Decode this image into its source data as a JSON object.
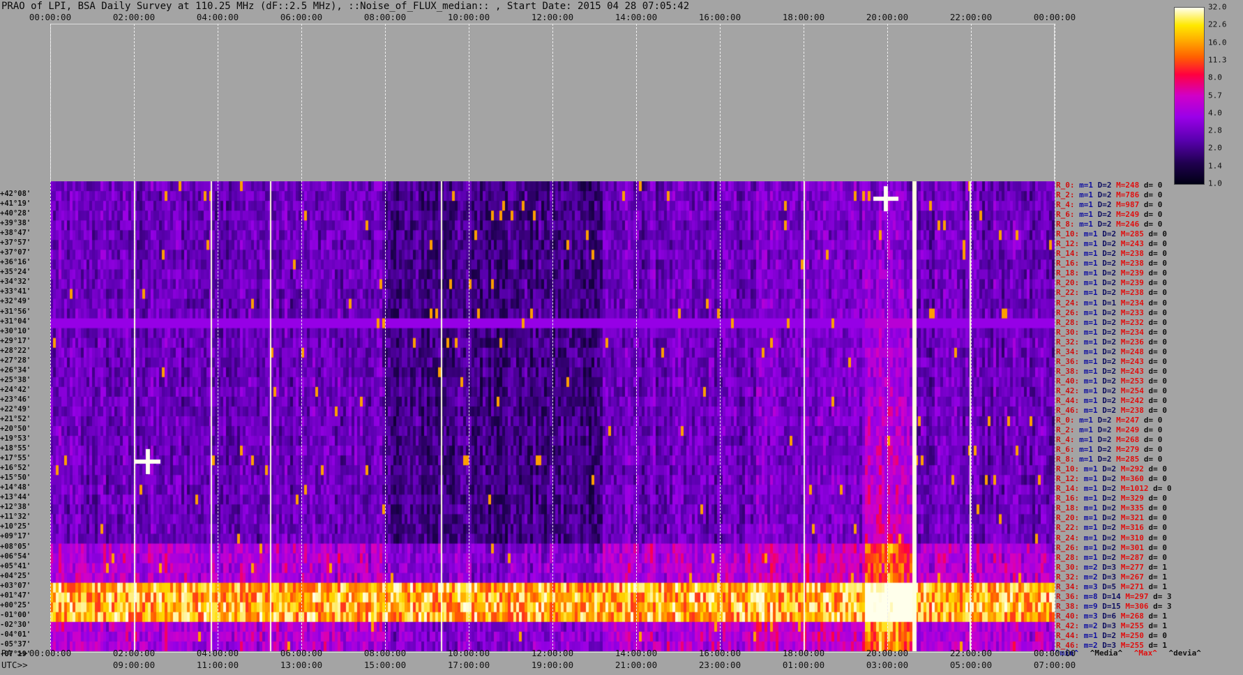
{
  "title": "PRAO of LPI, BSA Daily Survey at 110.25 MHz (dF::2.5 MHz), ::Noise_of_FLUX_median:: , Start Date: 2015 04 28 07:05:42",
  "top_axis": [
    "00:00:00",
    "02:00:00",
    "04:00:00",
    "06:00:00",
    "08:00:00",
    "10:00:00",
    "12:00:00",
    "14:00:00",
    "16:00:00",
    "18:00:00",
    "20:00:00",
    "22:00:00",
    "00:00:00"
  ],
  "ra_label": "RA >>",
  "ra_axis": [
    "00:00:00",
    "02:00:00",
    "04:00:00",
    "06:00:00",
    "08:00:00",
    "10:00:00",
    "12:00:00",
    "14:00:00",
    "16:00:00",
    "18:00:00",
    "20:00:00",
    "22:00:00",
    "00:00:00"
  ],
  "utc_label": "UTC>>",
  "utc_axis": [
    "09:00:00",
    "11:00:00",
    "13:00:00",
    "15:00:00",
    "17:00:00",
    "19:00:00",
    "21:00:00",
    "23:00:00",
    "01:00:00",
    "03:00:00",
    "05:00:00",
    "07:00:00"
  ],
  "declinations": [
    "+42°08'",
    "+41°19'",
    "+40°28'",
    "+39°38'",
    "+38°47'",
    "+37°57'",
    "+37°07'",
    "+36°16'",
    "+35°24'",
    "+34°32'",
    "+33°41'",
    "+32°49'",
    "+31°56'",
    "+31°04'",
    "+30°10'",
    "+29°17'",
    "+28°22'",
    "+27°28'",
    "+26°34'",
    "+25°38'",
    "+24°42'",
    "+23°46'",
    "+22°49'",
    "+21°52'",
    "+20°50'",
    "+19°53'",
    "+18°55'",
    "+17°55'",
    "+16°52'",
    "+15°50'",
    "+14°48'",
    "+13°44'",
    "+12°38'",
    "+11°32'",
    "+10°25'",
    "+09°17'",
    "+08°05'",
    "+06°54'",
    "+05°41'",
    "+04°25'",
    "+03°07'",
    "+01°47'",
    "+00°25'",
    "-01°00'",
    "-02°30'",
    "-04°01'",
    "-05°37'",
    "-07°19'"
  ],
  "stats": [
    [
      "R_0:",
      "1",
      "2",
      "248",
      "0"
    ],
    [
      "R_2:",
      "1",
      "2",
      "786",
      "0"
    ],
    [
      "R_4:",
      "1",
      "2",
      "987",
      "0"
    ],
    [
      "R_6:",
      "1",
      "2",
      "249",
      "0"
    ],
    [
      "R_8:",
      "1",
      "2",
      "246",
      "0"
    ],
    [
      "R_10:",
      "1",
      "2",
      "285",
      "0"
    ],
    [
      "R_12:",
      "1",
      "2",
      "243",
      "0"
    ],
    [
      "R_14:",
      "1",
      "2",
      "238",
      "0"
    ],
    [
      "R_16:",
      "1",
      "2",
      "238",
      "0"
    ],
    [
      "R_18:",
      "1",
      "2",
      "239",
      "0"
    ],
    [
      "R_20:",
      "1",
      "2",
      "239",
      "0"
    ],
    [
      "R_22:",
      "1",
      "2",
      "238",
      "0"
    ],
    [
      "R_24:",
      "1",
      "1",
      "234",
      "0"
    ],
    [
      "R_26:",
      "1",
      "2",
      "233",
      "0"
    ],
    [
      "R_28:",
      "1",
      "2",
      "232",
      "0"
    ],
    [
      "R_30:",
      "1",
      "2",
      "234",
      "0"
    ],
    [
      "R_32:",
      "1",
      "2",
      "236",
      "0"
    ],
    [
      "R_34:",
      "1",
      "2",
      "248",
      "0"
    ],
    [
      "R_36:",
      "1",
      "2",
      "243",
      "0"
    ],
    [
      "R_38:",
      "1",
      "2",
      "243",
      "0"
    ],
    [
      "R_40:",
      "1",
      "2",
      "253",
      "0"
    ],
    [
      "R_42:",
      "1",
      "2",
      "254",
      "0"
    ],
    [
      "R_44:",
      "1",
      "2",
      "242",
      "0"
    ],
    [
      "R_46:",
      "1",
      "2",
      "238",
      "0"
    ],
    [
      "R_0:",
      "1",
      "2",
      "247",
      "0"
    ],
    [
      "R_2:",
      "1",
      "2",
      "249",
      "0"
    ],
    [
      "R_4:",
      "1",
      "2",
      "268",
      "0"
    ],
    [
      "R_6:",
      "1",
      "2",
      "279",
      "0"
    ],
    [
      "R_8:",
      "1",
      "2",
      "285",
      "0"
    ],
    [
      "R_10:",
      "1",
      "2",
      "292",
      "0"
    ],
    [
      "R_12:",
      "1",
      "2",
      "360",
      "0"
    ],
    [
      "R_14:",
      "1",
      "2",
      "1012",
      "0"
    ],
    [
      "R_16:",
      "1",
      "2",
      "329",
      "0"
    ],
    [
      "R_18:",
      "1",
      "2",
      "335",
      "0"
    ],
    [
      "R_20:",
      "1",
      "2",
      "321",
      "0"
    ],
    [
      "R_22:",
      "1",
      "2",
      "316",
      "0"
    ],
    [
      "R_24:",
      "1",
      "2",
      "310",
      "0"
    ],
    [
      "R_26:",
      "1",
      "2",
      "301",
      "0"
    ],
    [
      "R_28:",
      "1",
      "2",
      "287",
      "0"
    ],
    [
      "R_30:",
      "2",
      "3",
      "277",
      "1"
    ],
    [
      "R_32:",
      "2",
      "3",
      "267",
      "1"
    ],
    [
      "R_34:",
      "3",
      "5",
      "271",
      "1"
    ],
    [
      "R_36:",
      "8",
      "14",
      "297",
      "3"
    ],
    [
      "R_38:",
      "9",
      "15",
      "306",
      "3"
    ],
    [
      "R_40:",
      "3",
      "6",
      "268",
      "1"
    ],
    [
      "R_42:",
      "2",
      "3",
      "255",
      "1"
    ],
    [
      "R_44:",
      "1",
      "2",
      "250",
      "0"
    ],
    [
      "R_46:",
      "2",
      "3",
      "255",
      "1"
    ]
  ],
  "legend_heads": {
    "min": "^min^",
    "median": "^Media^",
    "max": "^Max^",
    "dev": "^devia^"
  },
  "colorbar_labels": [
    "32.0",
    "22.6",
    "16.0",
    "11.3",
    "8.0",
    "5.7",
    "4.0",
    "2.8",
    "2.0",
    "1.4",
    "1.0"
  ],
  "colors": {
    "background": "#a4a4a4",
    "label_red": "#d01010",
    "max_red": "#e01010",
    "min_blue": "#1010a0"
  }
}
